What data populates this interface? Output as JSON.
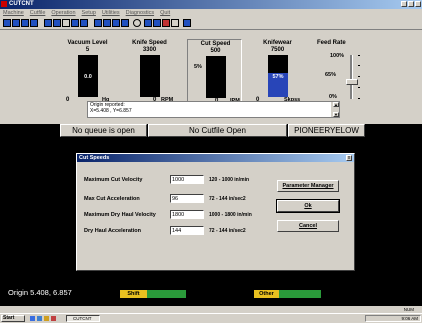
{
  "window": {
    "title": "CUTCNT"
  },
  "menu": [
    "Machine",
    "Cutfile",
    "Operation",
    "Setup",
    "Utilities",
    "Diagnostics",
    "Quit"
  ],
  "gauges": {
    "vacuum": {
      "label": "Vacuum Level",
      "value": "5",
      "reading": "0.0",
      "zero": "0",
      "unit": "Hg"
    },
    "knife": {
      "label": "Knife Speed",
      "value": "3300",
      "zero": "0",
      "unit": "RPM"
    },
    "cut": {
      "label": "Cut Speed",
      "value": "500",
      "percent": "5%",
      "zero": "0",
      "unit": "IPM"
    },
    "knifewear": {
      "label": "Knifewear",
      "value": "7500",
      "fill_percent": "57%",
      "zero": "0",
      "unit": "Skpss"
    }
  },
  "feed_rate": {
    "label": "Feed Rate",
    "levels": [
      "100%",
      "65%",
      "0%"
    ]
  },
  "messages": [
    "Origin reported:",
    "X=5.408 , Y=6.857"
  ],
  "status": {
    "queue": "No queue is open",
    "cutfile": "No Cutfile Open",
    "setup": "PIONEERYELOW Setup"
  },
  "dialog": {
    "title": "Cut Speeds",
    "close": "x",
    "fields": [
      {
        "label": "Maximum Cut Velocity",
        "value": "1000",
        "range": "120 - 1000 in/min"
      },
      {
        "label": "Max Cut Acceleration",
        "value": "96",
        "range": "72 - 144 in/sec2"
      },
      {
        "label": "Maximum Dry Haul Velocity",
        "value": "1800",
        "range": "1000 - 1800 in/min"
      },
      {
        "label": "Dry Haul Acceleration",
        "value": "144",
        "range": "72 - 144 in/sec2"
      }
    ],
    "buttons": {
      "param": "Parameter Manager",
      "ok": "Ok",
      "cancel": "Cancel"
    }
  },
  "origin": "Origin 5.408, 6.857",
  "shifts": {
    "shift": "Shift",
    "other": "Other"
  },
  "strip_text": "NUM",
  "taskbar": {
    "start": "Start",
    "task": "CUTCNT",
    "clock": "9:06 AM"
  },
  "colors": {
    "title_gradient_start": "#0a246a",
    "knifewear_fill": "#2845b8",
    "shift_yellow": "#e8c020",
    "shift_green": "#2a9a3a"
  }
}
